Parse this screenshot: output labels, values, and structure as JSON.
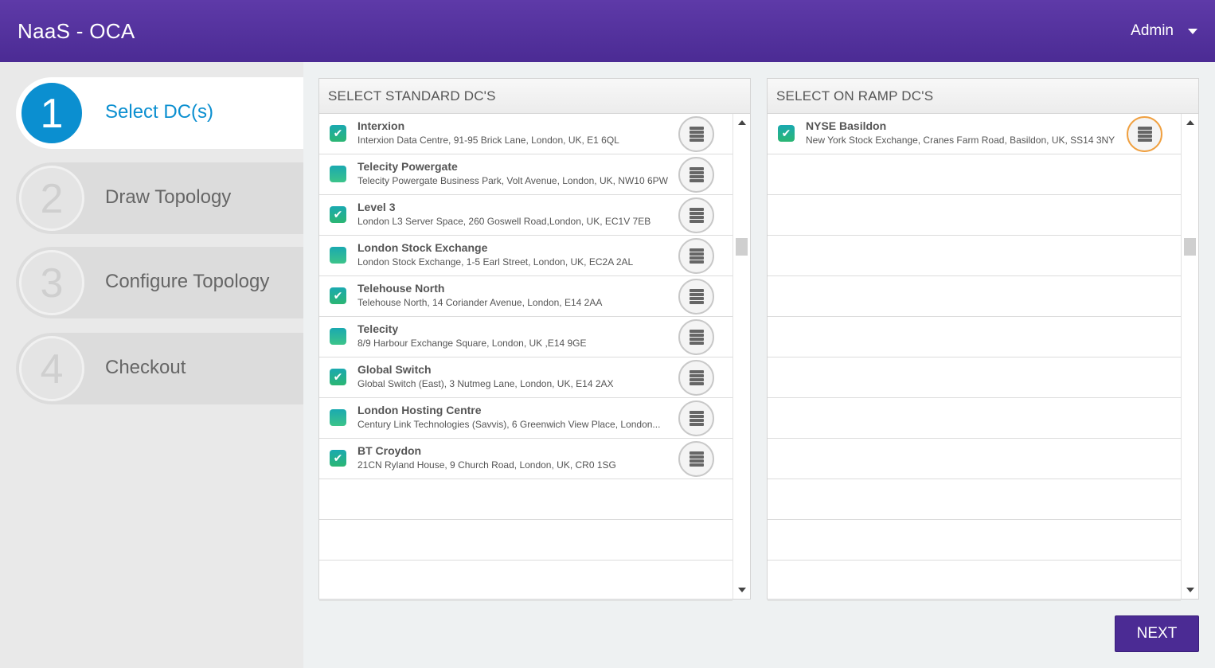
{
  "header": {
    "title": "NaaS - OCA",
    "user": "Admin"
  },
  "steps": [
    {
      "num": "1",
      "label": "Select DC(s)"
    },
    {
      "num": "2",
      "label": "Draw Topology"
    },
    {
      "num": "3",
      "label": "Configure Topology"
    },
    {
      "num": "4",
      "label": "Checkout"
    }
  ],
  "standard": {
    "title": "SELECT STANDARD DC'S",
    "items": [
      {
        "name": "Interxion",
        "address": "Interxion Data Centre, 91-95 Brick Lane, London, UK, E1 6QL",
        "checked": true
      },
      {
        "name": "Telecity Powergate",
        "address": "Telecity Powergate Business Park, Volt Avenue, London, UK, NW10 6PW",
        "checked": false
      },
      {
        "name": "Level 3",
        "address": "London L3 Server Space, 260 Goswell Road,London, UK, EC1V 7EB",
        "checked": true
      },
      {
        "name": "London Stock Exchange",
        "address": "London Stock Exchange, 1-5 Earl Street, London, UK, EC2A 2AL",
        "checked": false
      },
      {
        "name": "Telehouse North",
        "address": "Telehouse North, 14 Coriander Avenue, London, E14 2AA",
        "checked": true
      },
      {
        "name": "Telecity",
        "address": "8/9 Harbour Exchange Square, London, UK ,E14 9GE",
        "checked": false
      },
      {
        "name": "Global Switch",
        "address": "Global Switch (East), 3 Nutmeg Lane, London, UK, E14 2AX",
        "checked": true
      },
      {
        "name": "London Hosting Centre",
        "address": "Century Link Technologies (Savvis), 6 Greenwich View Place, London...",
        "checked": false
      },
      {
        "name": "BT Croydon",
        "address": "21CN Ryland House, 9 Church Road, London, UK, CR0 1SG",
        "checked": true
      }
    ]
  },
  "onramp": {
    "title": "SELECT ON RAMP DC'S",
    "items": [
      {
        "name": "NYSE Basildon",
        "address": "New York Stock Exchange, Cranes Farm Road, Basildon, UK, SS14 3NY",
        "checked": true
      }
    ]
  },
  "next_label": "NEXT",
  "icons": {
    "server": "server-icon",
    "check": "check-icon",
    "caret": "caret-down-icon"
  },
  "colors": {
    "header": "#4b2b94",
    "accent": "#0b8fd0",
    "check": "#2bb673",
    "highlight": "#f0a040"
  }
}
